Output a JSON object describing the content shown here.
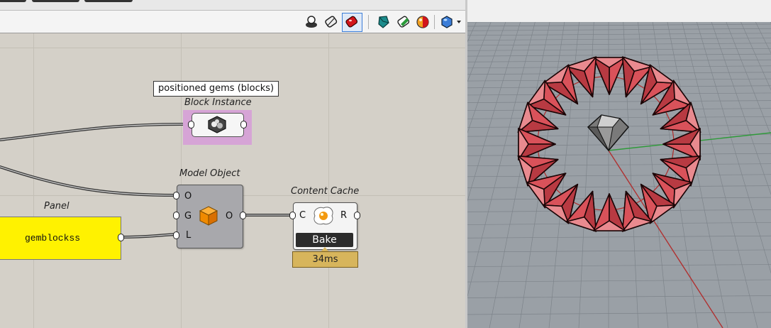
{
  "tooltip": {
    "text": "positioned gems (blocks)"
  },
  "components": {
    "block_instance": {
      "title": "Block Instance"
    },
    "model_object": {
      "title": "Model Object",
      "inputs": [
        "O",
        "G",
        "L"
      ],
      "output": "O"
    },
    "content_cache": {
      "title": "Content Cache",
      "input": "C",
      "output": "R",
      "bake_label": "Bake",
      "timer": "34ms"
    },
    "panel": {
      "title": "Panel",
      "text": "gemblockss"
    }
  },
  "toolbar": {
    "icons": [
      "preview-wire-icon",
      "preview-shaded-icon",
      "preview-selected-icon",
      "display-mode-icon",
      "preview-mesh-icon",
      "preview-color-icon",
      "preview-settings-icon"
    ]
  },
  "colors": {
    "canvas": "#d4d0c8",
    "panel_fill": "#fff200",
    "selected_highlight": "#d6a4d6",
    "timer_fill": "#d7b55c",
    "gem_red": "#d9525a",
    "viewport_bg": "#9aa0a6"
  }
}
